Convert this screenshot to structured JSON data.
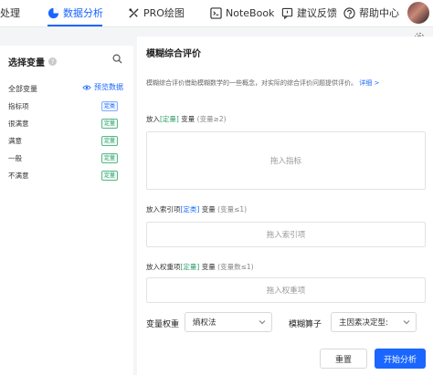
{
  "nav": {
    "items": [
      {
        "label": "处理",
        "icon": "none"
      },
      {
        "label": "数据分析",
        "icon": "pie-chart-icon",
        "active": true
      },
      {
        "label": "PRO绘图",
        "icon": "pro-icon"
      },
      {
        "label": "NoteBook",
        "icon": "code-icon"
      },
      {
        "label": "建议反馈",
        "icon": "feedback-icon"
      },
      {
        "label": "帮助中心",
        "icon": "help-icon"
      }
    ],
    "accent": "#1a66ff"
  },
  "left": {
    "title": "选择变量",
    "all_vars": "全部变量",
    "preview": "预览数据",
    "vars": [
      {
        "name": "指标项",
        "tag": "定类",
        "tag_color": "blue"
      },
      {
        "name": "很满意",
        "tag": "定量",
        "tag_color": "green"
      },
      {
        "name": "满意",
        "tag": "定量",
        "tag_color": "green"
      },
      {
        "name": "一般",
        "tag": "定量",
        "tag_color": "green"
      },
      {
        "name": "不满意",
        "tag": "定量",
        "tag_color": "green"
      }
    ]
  },
  "main": {
    "title": "模糊综合评价",
    "desc": "模糊综合评价借助模糊数学的一些概念，对实际的综合评价问题提供评价。",
    "desc_link": "详细 >",
    "sec1": {
      "pre": "放入",
      "tag": "[定量]",
      "post": "变量",
      "limit": "(变量≥2)",
      "placeholder": "拖入指标"
    },
    "sec2": {
      "pre": "放入索引项",
      "tag": "[定类]",
      "post": "变量",
      "limit": "(变量≤1)",
      "placeholder": "拖入索引项"
    },
    "sec3": {
      "pre": "放入权重项",
      "tag": "[定量]",
      "post": "变量",
      "limit": "(变量数≤1)",
      "placeholder": "拖入权重项"
    },
    "weight_label": "变量权重",
    "weight_value": "熵权法",
    "operator_label": "模糊算子",
    "operator_value": "主因素决定型:",
    "reset": "重置",
    "start": "开始分析"
  }
}
